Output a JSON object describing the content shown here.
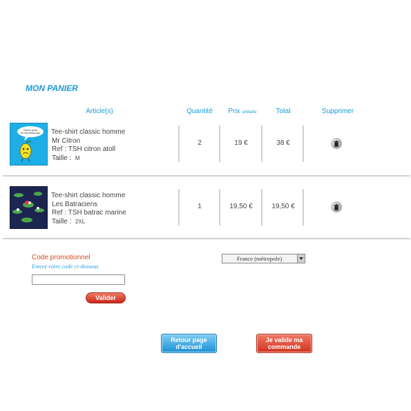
{
  "page": {
    "title": "MON PANIER"
  },
  "table_headers": {
    "articles": "Article(s)",
    "quantity": "Quantité",
    "price": "Prix",
    "price_suffix": "unitaire",
    "total": "Total",
    "delete": "Supprimer"
  },
  "items": [
    {
      "name": "Tee-shirt classic homme",
      "design": "Mr Citron",
      "ref": "Ref : TSH citron atoll",
      "size_label": "Taille :",
      "size": "M",
      "quantity": "2",
      "unit_price": "19 €",
      "total": "38 €",
      "thumb_color": "#1eaee8",
      "thumb_text": "Pourvu qu'on ne me presse pas"
    },
    {
      "name": "Tee-shirt classic homme",
      "design": "Les Batraciens",
      "ref": "Ref : TSH batrac marine",
      "size_label": "Taille :",
      "size": "2XL",
      "quantity": "1",
      "unit_price": "19,50 €",
      "total": "19,50 €",
      "thumb_color": "#1c2550"
    }
  ],
  "promo": {
    "label": "Code promotionnel",
    "hint": "Entrez votre code ci-dessous",
    "value": "",
    "submit": "Valider"
  },
  "shipping": {
    "selected": "France (métropole)"
  },
  "actions": {
    "home_line1": "Retour page",
    "home_line2": "d'accueil",
    "order_line1": "Je valide ma",
    "order_line2": "commande"
  }
}
